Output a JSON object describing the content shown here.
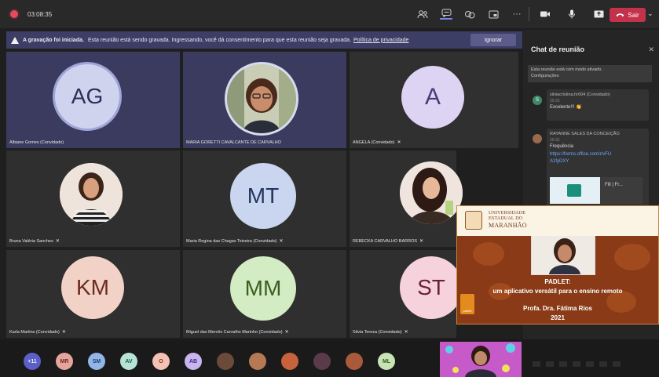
{
  "topbar": {
    "timer": "03:08:35",
    "leave_label": "Sair",
    "icons": [
      "participants-icon",
      "chat-icon",
      "reactions-icon",
      "rooms-icon",
      "more-icon",
      "camera-icon",
      "mic-icon",
      "share-icon"
    ]
  },
  "banner": {
    "bold": "A gravação foi iniciada.",
    "text": "Esta reunião está sendo gravada. Ingressando, você dá consentimento para que esta reunião seja gravada.",
    "link": "Política de privacidade",
    "ignore_label": "Ignorar"
  },
  "tiles": [
    {
      "name": "Albiane Gomes (Convidado)",
      "initials": "AG"
    },
    {
      "name": "MARIA GORETTI CAVALCANTE DE CARVALHO",
      "initials": ""
    },
    {
      "name": "ANGELA (Convidado)",
      "initials": "A"
    },
    {
      "name": "Bruna Valéria Sanches",
      "initials": ""
    },
    {
      "name": "Maria Regina das Chagas Teixeira (Convidado)",
      "initials": "MT"
    },
    {
      "name": "REBECKA CARVALHO BARROS",
      "initials": ""
    },
    {
      "name": "Karla Martins (Convidado)",
      "initials": "KM"
    },
    {
      "name": "Miguel das Mercês Carvalho Marinho (Convidado)",
      "initials": "MM"
    },
    {
      "name": "Silvia Tereza (Convidado)",
      "initials": "ST"
    }
  ],
  "chat": {
    "title": "Chat de reunião",
    "notice_line1": "Esta reunião está com modo ativado.",
    "notice_line2": "Configurações",
    "messages": [
      {
        "avatar": "S",
        "sender": "silviacristina.hr004 (Convidado)",
        "time": "20:23",
        "text": "Excelente!!! 👏"
      },
      {
        "sender": "RAYANNE SALES DA CONCEIÇÃO",
        "time": "20:31",
        "text": "Frequência",
        "link": "https://forms.office.com/r/vFUA1fyDXY",
        "card": "Fill | Fr..."
      }
    ]
  },
  "slide": {
    "uni_line1": "UNIVERSIDADE",
    "uni_line2": "ESTADUAL DO",
    "uni_line3": "MARANHÃO",
    "padlet_label": "padlet",
    "title1": "PADLET:",
    "title2": "um aplicativo versátil para o ensino remoto",
    "author": "Profa. Dra. Fátima Rios",
    "year": "2021"
  },
  "bottom": {
    "bubbles": [
      {
        "label": "+11",
        "bg": "#5b5fc7",
        "fg": "#e8e8ff"
      },
      {
        "label": "MR",
        "bg": "#e6a59c",
        "fg": "#6b2b24"
      },
      {
        "label": "SM",
        "bg": "#93b6e8",
        "fg": "#1f3f6e"
      },
      {
        "label": "AV",
        "bg": "#b7e3d6",
        "fg": "#1f5a48"
      },
      {
        "label": "O",
        "bg": "#f3c2b4",
        "fg": "#7a3a24"
      },
      {
        "label": "AB",
        "bg": "#c9b4f0",
        "fg": "#3c2a78"
      },
      {
        "label": "",
        "bg": "#6b4a3a",
        "fg": "#fff"
      },
      {
        "label": "",
        "bg": "#b57a54",
        "fg": "#fff"
      },
      {
        "label": "",
        "bg": "#c8623d",
        "fg": "#fff"
      },
      {
        "label": "",
        "bg": "#5b3a4a",
        "fg": "#fff"
      },
      {
        "label": "",
        "bg": "#a85a3a",
        "fg": "#fff"
      },
      {
        "label": "ML",
        "bg": "#c8e4b4",
        "fg": "#335a20"
      }
    ]
  }
}
